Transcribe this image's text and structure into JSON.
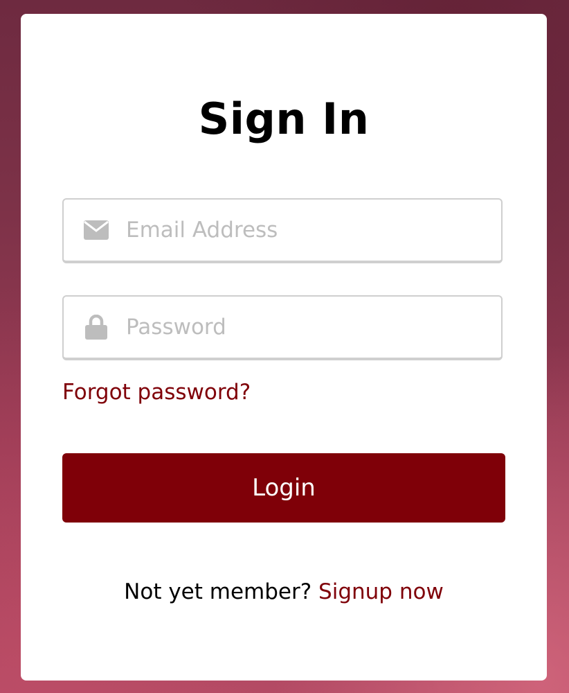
{
  "form": {
    "title": "Sign In",
    "email": {
      "placeholder": "Email Address",
      "value": "",
      "icon": "envelope-icon"
    },
    "password": {
      "placeholder": "Password",
      "value": "",
      "icon": "lock-icon"
    },
    "forgot_label": "Forgot password?",
    "login_label": "Login",
    "signup_prompt": "Not yet member?",
    "signup_link": "Signup now"
  },
  "colors": {
    "accent": "#7f0008",
    "placeholder": "#bdbdbd",
    "icon": "#bdbdbd",
    "field_border": "#cfcfcf",
    "card": "#ffffff"
  }
}
